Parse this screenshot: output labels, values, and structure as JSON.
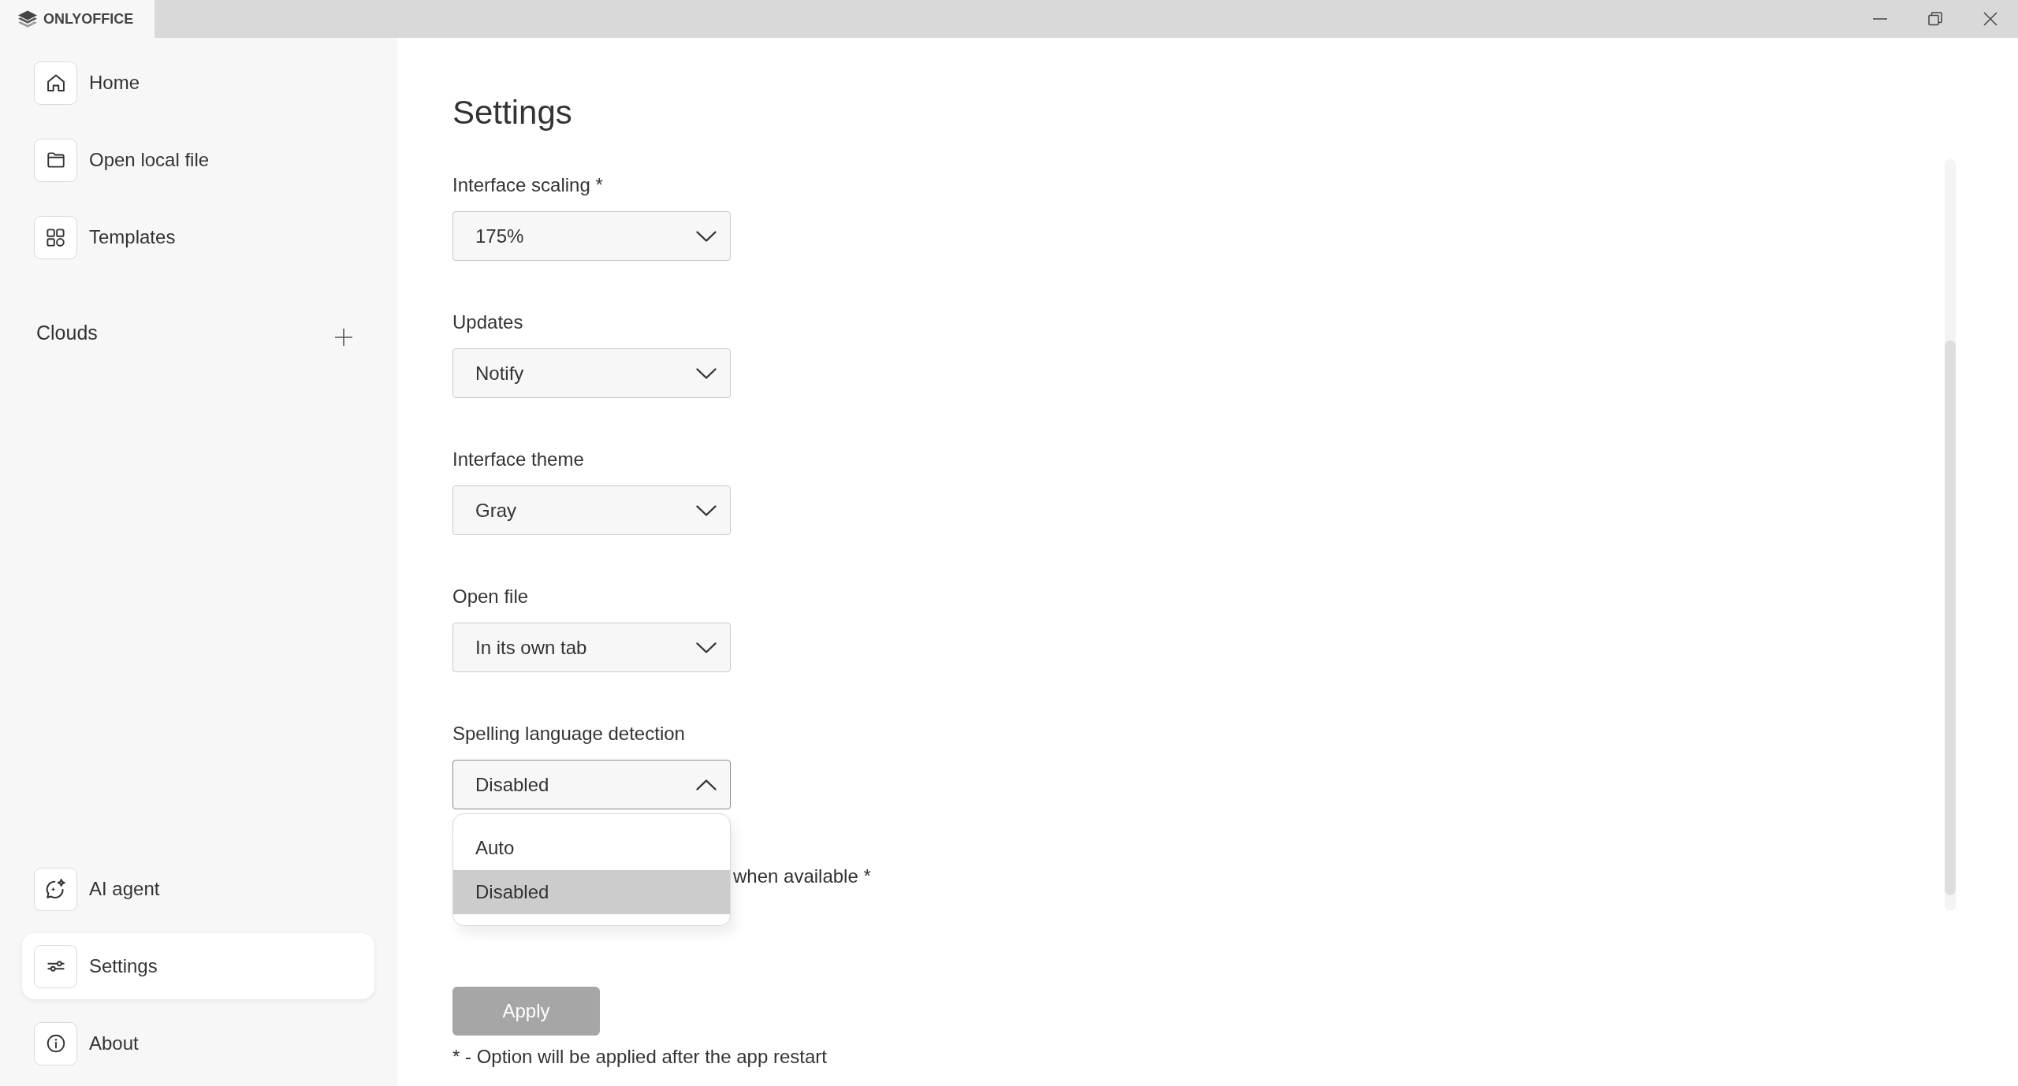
{
  "window": {
    "logo_text": "ONLYOFFICE"
  },
  "sidebar": {
    "top_items": [
      {
        "label": "Home",
        "selected": false
      },
      {
        "label": "Open local file",
        "selected": false
      },
      {
        "label": "Templates",
        "selected": false
      }
    ],
    "clouds": {
      "title": "Clouds"
    },
    "bottom_items": [
      {
        "label": "AI agent",
        "selected": false
      },
      {
        "label": "Settings",
        "selected": true
      },
      {
        "label": "About",
        "selected": false
      }
    ]
  },
  "settings": {
    "title": "Settings",
    "fields": [
      {
        "label": "Interface scaling *",
        "value": "175%",
        "expanded": false
      },
      {
        "label": "Updates",
        "value": "Notify",
        "expanded": false
      },
      {
        "label": "Interface theme",
        "value": "Gray",
        "expanded": false
      },
      {
        "label": "Open file",
        "value": "In its own tab",
        "expanded": false
      },
      {
        "label": "Spelling language detection",
        "value": "Disabled",
        "expanded": true,
        "options": [
          {
            "label": "Auto",
            "selected": false
          },
          {
            "label": "Disabled",
            "selected": true
          }
        ]
      }
    ],
    "covered_option_text": "when available *",
    "apply_button": {
      "label": "Apply",
      "disabled": true
    },
    "footnote": "* - Option will be applied after the app restart"
  }
}
